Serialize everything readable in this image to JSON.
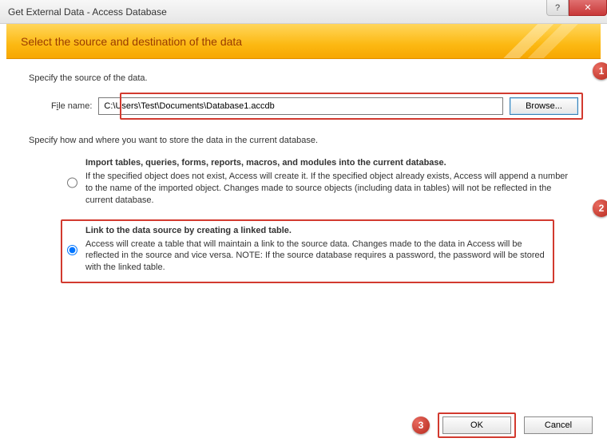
{
  "titlebar": {
    "title": "Get External Data - Access Database",
    "help": "?",
    "close": "✕"
  },
  "banner": {
    "heading": "Select the source and destination of the data"
  },
  "source": {
    "prompt": "Specify the source of the data.",
    "file_label_pre": "F",
    "file_label_u": "i",
    "file_label_post": "le name:",
    "file_value": "C:\\Users\\Test\\Documents\\Database1.accdb",
    "browse": "Browse..."
  },
  "store": {
    "prompt": "Specify how and where you want to store the data in the current database.",
    "opt_import": {
      "title": "Import tables, queries, forms, reports, macros, and modules into the current database.",
      "desc": "If the specified object does not exist, Access will create it. If the specified object already exists, Access will append a number to the name of the imported object. Changes made to source objects (including data in tables) will not be reflected in the current database."
    },
    "opt_link": {
      "title": "Link to the data source by creating a linked table.",
      "desc": "Access will create a table that will maintain a link to the source data. Changes made to the data in Access will be reflected in the source and vice versa. NOTE:  If the source database requires a password, the password will be stored with the linked table."
    }
  },
  "footer": {
    "ok": "OK",
    "cancel": "Cancel"
  },
  "annotations": {
    "b1": "1",
    "b2": "2",
    "b3": "3"
  }
}
